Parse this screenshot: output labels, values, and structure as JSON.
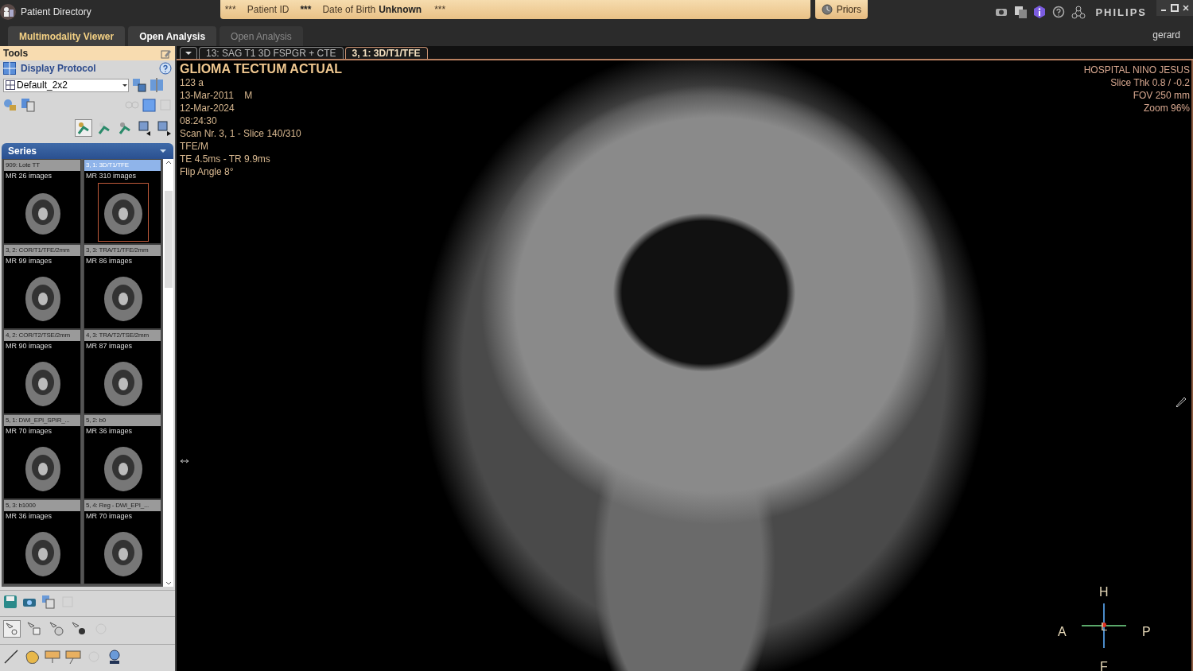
{
  "window": {
    "title": "Patient Directory"
  },
  "patient_banner": {
    "name": "***",
    "patient_id_label": "Patient ID",
    "patient_id": "***",
    "dob_label": "Date of Birth",
    "dob": "Unknown",
    "extra": "***"
  },
  "priors_button": "Priors",
  "brand": "PHILIPS",
  "user": "gerard",
  "tabs": [
    {
      "label": "Multimodality Viewer",
      "selected": true,
      "disabled": false
    },
    {
      "label": "Open Analysis",
      "selected": false,
      "disabled": false
    },
    {
      "label": "Open Analysis",
      "selected": false,
      "disabled": true
    }
  ],
  "tools": {
    "title": "Tools",
    "display_protocol": "Display Protocol",
    "protocol": "Default_2x2"
  },
  "series": {
    "title": "Series",
    "items": [
      {
        "title": "909: Lote TT",
        "count": "MR 26 images",
        "selected": false
      },
      {
        "title": "3, 1: 3D/T1/TFE",
        "count": "MR 310 images",
        "selected": true
      },
      {
        "title": "3, 2: COR/T1/TFE/2mm",
        "count": "MR 99 images",
        "selected": false
      },
      {
        "title": "3, 3: TRA/T1/TFE/2mm",
        "count": "MR 86 images",
        "selected": false
      },
      {
        "title": "4, 2: COR/T2/TSE/2mm",
        "count": "MR 90 images",
        "selected": false
      },
      {
        "title": "4, 3: TRA/T2/TSE/2mm",
        "count": "MR 87 images",
        "selected": false
      },
      {
        "title": "5, 1: DWI_EPI_SPIR_...",
        "count": "MR 70 images",
        "selected": false
      },
      {
        "title": "5, 2: b0",
        "count": "MR 36 images",
        "selected": false
      },
      {
        "title": "5, 3: b1000",
        "count": "MR 36 images",
        "selected": false
      },
      {
        "title": "5, 4: Reg - DWI_EPI_...",
        "count": "MR 70 images",
        "selected": false
      }
    ]
  },
  "viewer": {
    "tabs": [
      {
        "label": "13: SAG T1 3D FSPGR + CTE",
        "selected": false
      },
      {
        "label": "3, 1: 3D/T1/TFE",
        "selected": true
      }
    ],
    "title": "GLIOMA TECTUM ACTUAL",
    "overlay_left": [
      "123 a",
      "13-Mar-2011    M",
      "12-Mar-2024",
      "08:24:30",
      "Scan Nr. 3, 1 - Slice 140/310",
      "TFE/M",
      "TE 4.5ms - TR 9.9ms",
      "Flip Angle 8°"
    ],
    "overlay_right": [
      "HOSPITAL NINO JESUS",
      "Slice Thk 0.8 / -0.2",
      "FOV 250 mm",
      "Zoom 96%"
    ],
    "orientation": {
      "top": "H",
      "left": "A",
      "right": "P",
      "bottom": "F",
      "center": "L"
    }
  }
}
